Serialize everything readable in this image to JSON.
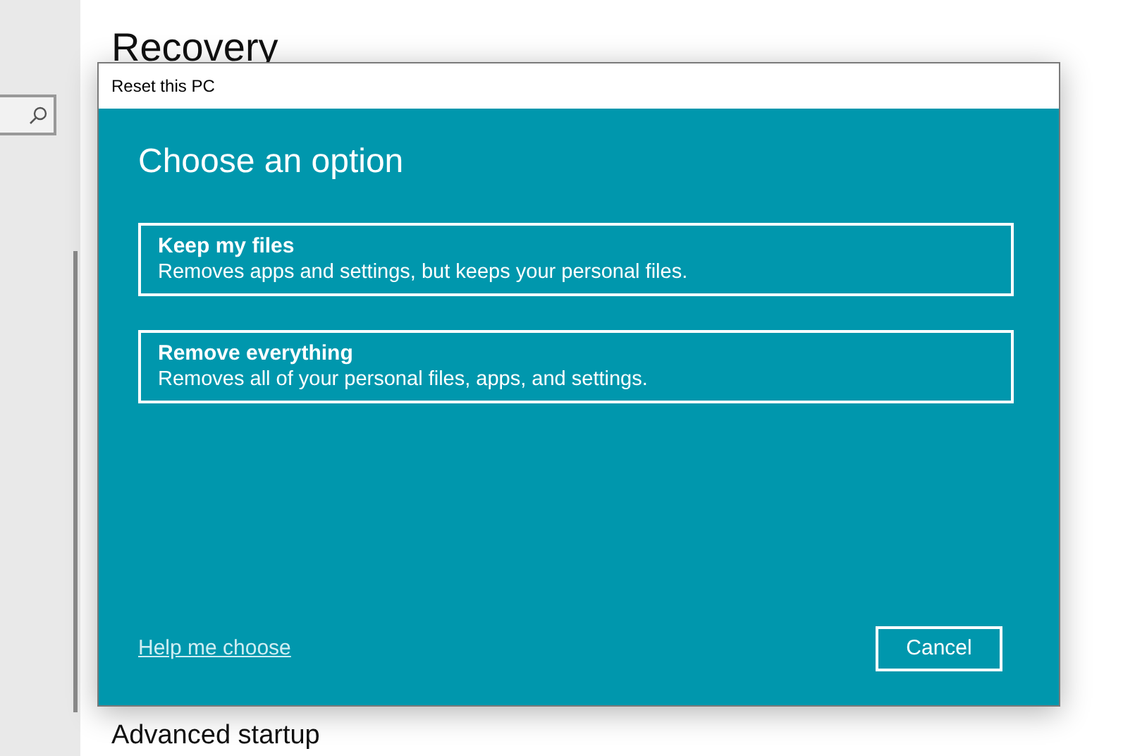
{
  "page": {
    "title": "Recovery",
    "section_heading": "Advanced startup"
  },
  "dialog": {
    "title": "Reset this PC",
    "heading": "Choose an option",
    "options": [
      {
        "title": "Keep my files",
        "description": "Removes apps and settings, but keeps your personal files."
      },
      {
        "title": "Remove everything",
        "description": "Removes all of your personal files, apps, and settings."
      }
    ],
    "help_link": "Help me choose",
    "cancel": "Cancel"
  }
}
